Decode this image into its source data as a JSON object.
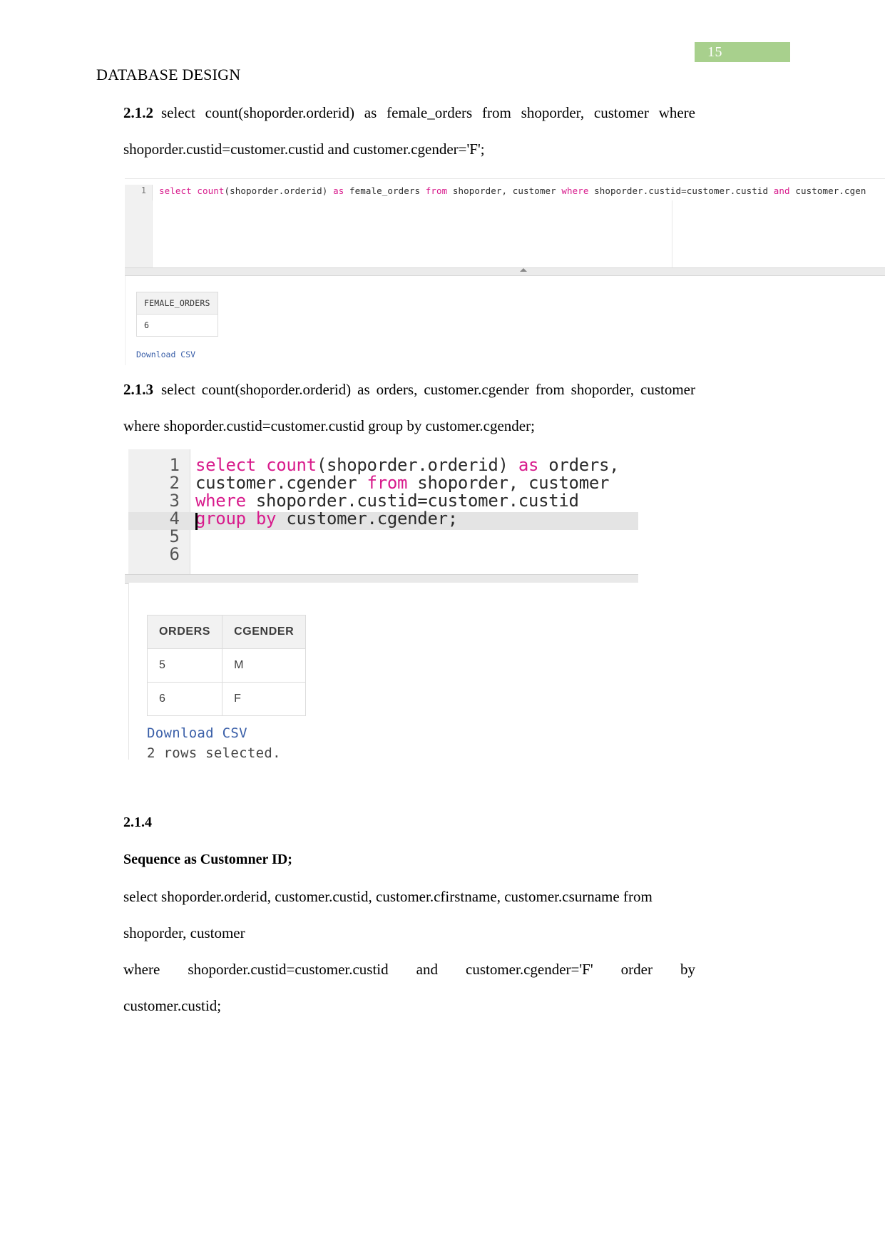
{
  "page": {
    "number": "15",
    "badge_color": "#a8d08d",
    "running_head": "DATABASE DESIGN"
  },
  "sections": {
    "s212": {
      "number": "2.1.2",
      "text": "select count(shoporder.orderid) as female_orders from shoporder, customer where shoporder.custid=customer.custid and customer.cgender='F';"
    },
    "s213": {
      "number": "2.1.3",
      "text": "select count(shoporder.orderid) as orders, customer.cgender from shoporder, customer where shoporder.custid=customer.custid group by customer.cgender;"
    },
    "s214": {
      "number": "2.1.4",
      "heading": "Sequence as Customner ID;",
      "line1": "select shoporder.orderid, customer.custid, customer.cfirstname, customer.csurname from",
      "line2": "shoporder, customer",
      "line3_part1": "where",
      "line3_part2": "shoporder.custid=customer.custid",
      "line3_part3": "and",
      "line3_part4": "customer.cgender='F'",
      "line3_part5": "order",
      "line3_part6": "by",
      "line4": "customer.custid;"
    }
  },
  "figure1": {
    "line_number": "1",
    "code_tokens": [
      {
        "t": "select",
        "c": "kw"
      },
      {
        "t": " ",
        "c": "plain"
      },
      {
        "t": "count",
        "c": "kw"
      },
      {
        "t": "(shoporder.orderid) ",
        "c": "plain"
      },
      {
        "t": "as",
        "c": "kw"
      },
      {
        "t": " female_orders ",
        "c": "plain"
      },
      {
        "t": "from",
        "c": "kw"
      },
      {
        "t": " shoporder, customer ",
        "c": "plain"
      },
      {
        "t": "where",
        "c": "kw"
      },
      {
        "t": " shoporder.custid=customer.custid ",
        "c": "plain"
      },
      {
        "t": "and",
        "c": "kw"
      },
      {
        "t": " customer.cgen",
        "c": "plain"
      }
    ],
    "result": {
      "header": "FEMALE_ORDERS",
      "value": "6"
    },
    "download_label": "Download CSV"
  },
  "figure2": {
    "lines": [
      {
        "n": "1",
        "tokens": [
          {
            "t": "select",
            "c": "kw"
          },
          {
            "t": " ",
            "c": "plain"
          },
          {
            "t": "count",
            "c": "kw"
          },
          {
            "t": "(shoporder.orderid) ",
            "c": "plain"
          },
          {
            "t": "as",
            "c": "kw"
          },
          {
            "t": " orders,",
            "c": "plain"
          }
        ]
      },
      {
        "n": "2",
        "tokens": [
          {
            "t": "customer.cgender ",
            "c": "plain"
          },
          {
            "t": "from",
            "c": "kw"
          },
          {
            "t": " shoporder, customer",
            "c": "plain"
          }
        ]
      },
      {
        "n": "3",
        "tokens": [
          {
            "t": "where",
            "c": "kw"
          },
          {
            "t": " shoporder.custid=customer.custid",
            "c": "plain"
          }
        ]
      },
      {
        "n": "4",
        "tokens": [
          {
            "t": "group",
            "c": "kw"
          },
          {
            "t": " ",
            "c": "plain"
          },
          {
            "t": "by",
            "c": "kw"
          },
          {
            "t": " customer.cgender;",
            "c": "plain"
          }
        ]
      },
      {
        "n": "5",
        "tokens": []
      },
      {
        "n": "6",
        "tokens": []
      }
    ],
    "result": {
      "headers": [
        "ORDERS",
        "CGENDER"
      ],
      "rows": [
        [
          "5",
          "M"
        ],
        [
          "6",
          "F"
        ]
      ]
    },
    "download_label": "Download CSV",
    "rows_message": "2 rows selected."
  }
}
